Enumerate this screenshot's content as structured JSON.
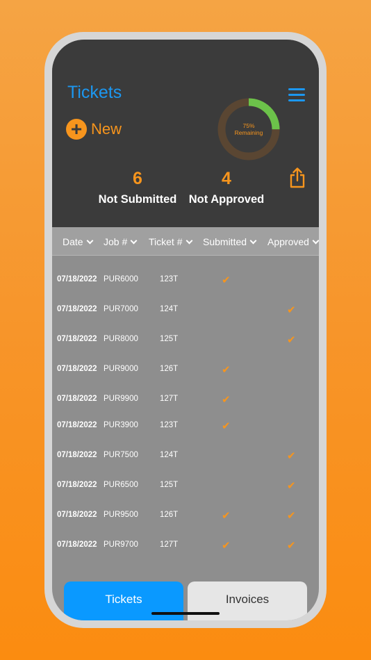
{
  "header": {
    "title": "Tickets",
    "new_label": "New",
    "donut": {
      "percent_label": "75%",
      "caption": "Remaining",
      "fraction_complete": 0.25
    },
    "stats": [
      {
        "count": "6",
        "label": "Not Submitted"
      },
      {
        "count": "4",
        "label": "Not Approved"
      }
    ]
  },
  "columns": [
    "Date",
    "Job #",
    "Ticket #",
    "Submitted",
    "Approved"
  ],
  "rows": [
    {
      "date": "07/18/2022",
      "job": "PUR6000",
      "ticket": "123T",
      "submitted": "✔",
      "approved": ""
    },
    {
      "date": "07/18/2022",
      "job": "PUR7000",
      "ticket": "124T",
      "submitted": "",
      "approved": "✔"
    },
    {
      "date": "07/18/2022",
      "job": "PUR8000",
      "ticket": "125T",
      "submitted": "",
      "approved": "✔"
    },
    {
      "date": "07/18/2022",
      "job": "PUR9000",
      "ticket": "126T",
      "submitted": "✔",
      "approved": ""
    },
    {
      "date": "07/18/2022",
      "job": "PUR9900",
      "ticket": "127T",
      "submitted": "✔",
      "approved": ""
    },
    {
      "date": "07/18/2022",
      "job": "PUR3900",
      "ticket": "123T",
      "submitted": "✔",
      "approved": ""
    },
    {
      "date": "07/18/2022",
      "job": "PUR7500",
      "ticket": "124T",
      "submitted": "",
      "approved": "✔"
    },
    {
      "date": "07/18/2022",
      "job": "PUR6500",
      "ticket": "125T",
      "submitted": "",
      "approved": "✔"
    },
    {
      "date": "07/18/2022",
      "job": "PUR9500",
      "ticket": "126T",
      "submitted": "✔",
      "approved": "✔"
    },
    {
      "date": "07/18/2022",
      "job": "PUR9700",
      "ticket": "127T",
      "submitted": "✔",
      "approved": "✔"
    }
  ],
  "tabs": {
    "tickets": "Tickets",
    "invoices": "Invoices"
  },
  "colors": {
    "accent_orange": "#f7951d",
    "accent_blue": "#1c97f0",
    "donut_green": "#6cc24a",
    "donut_track": "#5a4632"
  }
}
